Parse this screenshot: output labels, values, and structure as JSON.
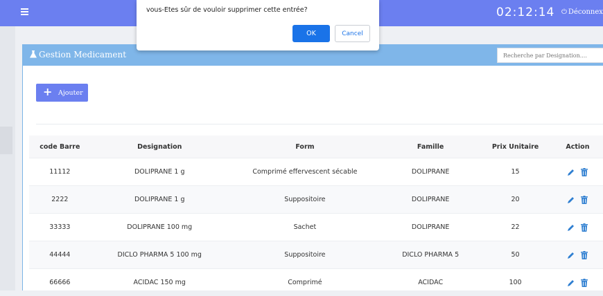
{
  "colors": {
    "accent": "#6b7ff0",
    "panel_header": "#7fb6e9",
    "dialog_button": "#1a73e8"
  },
  "header": {
    "clock": "02:12:14",
    "logout_label": "Déconnexion",
    "logout_icon": "power-icon",
    "menu_icon": "hamburger-menu-icon"
  },
  "dialog": {
    "message": "vous-Etes sûr de vouloir supprimer cette entrée?",
    "ok_label": "OK",
    "cancel_label": "Cancel"
  },
  "panel": {
    "title": "Gestion Medicament",
    "title_icon": "flask-icon",
    "search_placeholder": "Recherche par Designation....",
    "add_button_label": "Ajouter"
  },
  "table": {
    "columns": [
      "code Barre",
      "Designation",
      "Form",
      "Famille",
      "Prix Unitaire",
      "Action"
    ],
    "rows": [
      {
        "code": "11112",
        "designation": "DOLIPRANE 1 g",
        "form": "Comprimé effervescent sécable",
        "famille": "DOLIPRANE",
        "prix": "15"
      },
      {
        "code": "2222",
        "designation": "DOLIPRANE 1 g",
        "form": "Suppositoire",
        "famille": "DOLIPRANE",
        "prix": "20"
      },
      {
        "code": "33333",
        "designation": "DOLIPRANE 100 mg",
        "form": "Sachet",
        "famille": "DOLIPRANE",
        "prix": "22"
      },
      {
        "code": "44444",
        "designation": "DICLO PHARMA 5 100 mg",
        "form": "Suppositoire",
        "famille": "DICLO PHARMA 5",
        "prix": "50"
      },
      {
        "code": "66666",
        "designation": "ACIDAC 150 mg",
        "form": "Comprimé",
        "famille": "ACIDAC",
        "prix": "100"
      }
    ]
  }
}
